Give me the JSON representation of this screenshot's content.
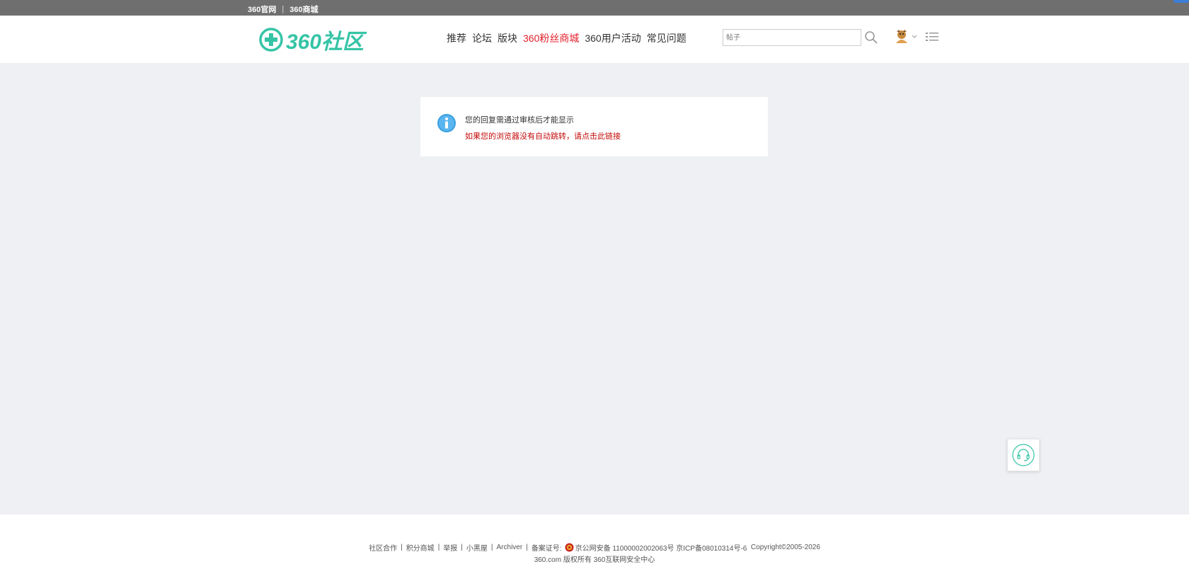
{
  "topbar": {
    "links": [
      "360官网",
      "360商城"
    ],
    "separator": "|"
  },
  "header": {
    "logo_text": "360社区",
    "nav": [
      "推荐",
      "论坛",
      "版块",
      "360粉丝商城",
      "360用户活动",
      "常见问题"
    ],
    "search_placeholder": "帖子"
  },
  "message": {
    "text": "您的回复需通过审核后才能显示",
    "redirect_link": "如果您的浏览器没有自动跳转，请点击此链接"
  },
  "footer": {
    "links": [
      "社区合作",
      "积分商城",
      "举报",
      "小黑屋",
      "Archiver"
    ],
    "separator": "|",
    "record_label": "备案证号:",
    "police_record": "京公网安备 11000002002063号",
    "icp": "京ICP备08010314号-6",
    "copyright": "Copyright©2005-2026",
    "owner": "360.com 版权所有 360互联网安全中心"
  },
  "colors": {
    "brand": "#35c4a6",
    "highlight_nav": "#e4202c",
    "link_red": "#c40b0b",
    "page_bg": "#eff0f4",
    "topbar_bg": "#6f6f6f"
  },
  "icons": [
    "info-icon",
    "search-icon",
    "avatar",
    "chevron-down-icon",
    "list-menu-icon",
    "headset-icon",
    "police-badge-icon"
  ]
}
